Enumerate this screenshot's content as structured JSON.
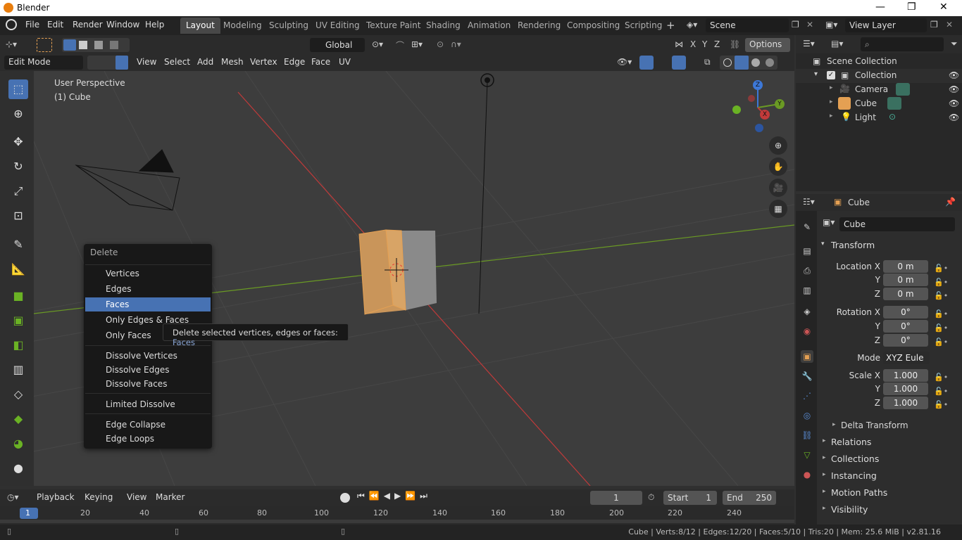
{
  "title": {
    "app": "Blender"
  },
  "menus": [
    "File",
    "Edit",
    "Render",
    "Window",
    "Help"
  ],
  "workspaces": [
    "Layout",
    "Modeling",
    "Sculpting",
    "UV Editing",
    "Texture Paint",
    "Shading",
    "Animation",
    "Rendering",
    "Compositing",
    "Scripting"
  ],
  "scene": {
    "name": "Scene",
    "view_layer": "View Layer"
  },
  "header": {
    "orientation": "Global",
    "options": "Options",
    "x": "X",
    "y": "Y",
    "z": "Z"
  },
  "edit": {
    "mode": "Edit Mode",
    "menus": [
      "View",
      "Select",
      "Add",
      "Mesh",
      "Vertex",
      "Edge",
      "Face",
      "UV"
    ]
  },
  "viewport": {
    "perspective": "User Perspective",
    "object": "(1) Cube"
  },
  "gizmo": {
    "z": "Z",
    "y": "Y",
    "x": "X"
  },
  "outliner": {
    "root": "Scene Collection",
    "collection": "Collection",
    "items": [
      "Camera",
      "Cube",
      "Light"
    ]
  },
  "properties": {
    "object": "Cube",
    "name": "Cube",
    "transform": "Transform",
    "loc_label": "Location X",
    "loc": [
      "0 m",
      "0 m",
      "0 m"
    ],
    "rot_label": "Rotation X",
    "rot": [
      "0°",
      "0°",
      "0°"
    ],
    "mode_label": "Mode",
    "mode": "XYZ Eule",
    "scale_label": "Scale X",
    "scale": [
      "1.000",
      "1.000",
      "1.000"
    ],
    "axis_y": "Y",
    "axis_z": "Z",
    "sections": [
      "Delta Transform",
      "Relations",
      "Collections",
      "Instancing",
      "Motion Paths",
      "Visibility"
    ]
  },
  "delete_menu": {
    "title": "Delete",
    "group1": [
      "Vertices",
      "Edges",
      "Faces",
      "Only Edges & Faces",
      "Only Faces"
    ],
    "group2": [
      "Dissolve Vertices",
      "Dissolve Edges",
      "Dissolve Faces"
    ],
    "group3": [
      "Limited Dissolve"
    ],
    "group4": [
      "Edge Collapse",
      "Edge Loops"
    ],
    "highlighted": "Faces"
  },
  "tooltip": {
    "text": "Delete selected vertices, edges or faces:",
    "value": "Faces"
  },
  "timeline": {
    "menus": [
      "Playback",
      "Keying",
      "View",
      "Marker"
    ],
    "frame": "1",
    "start_label": "Start",
    "start": "1",
    "end_label": "End",
    "end": "250",
    "ticks": [
      "1",
      "20",
      "40",
      "60",
      "80",
      "100",
      "120",
      "140",
      "160",
      "180",
      "200",
      "220",
      "240"
    ]
  },
  "status": "Cube | Verts:8/12 | Edges:12/20 | Faces:5/10 | Tris:20 | Mem: 25.6 MiB | v2.81.16",
  "colors": {
    "accent": "#4772b3",
    "select": "#e4a053",
    "x_axis": "#c23a3a",
    "y_axis": "#6a9a24"
  }
}
